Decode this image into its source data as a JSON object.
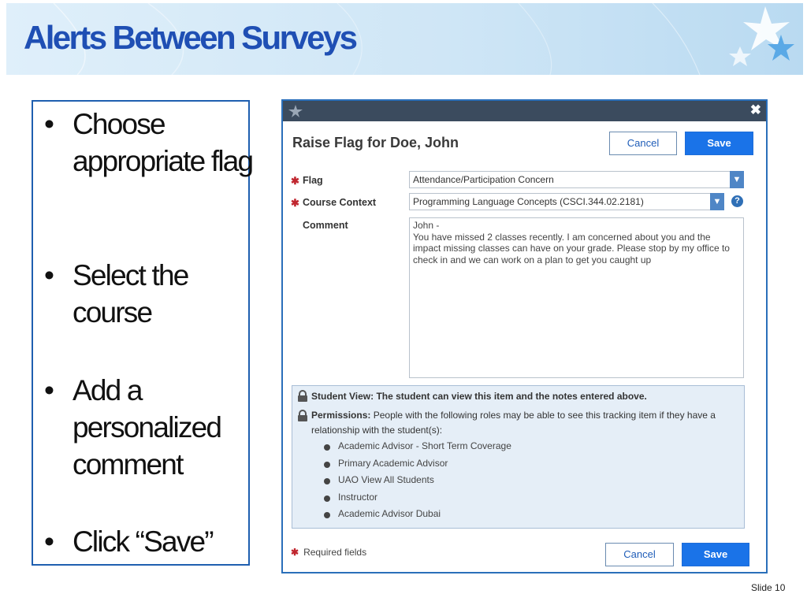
{
  "slide": {
    "title": "Alerts Between Surveys",
    "slide_number": "Slide 10",
    "bullets": [
      "Choose appropriate flag",
      "Select the course",
      "Add a personalized comment",
      "Click “Save”"
    ]
  },
  "dialog": {
    "heading": "Raise Flag for Doe, John",
    "close_glyph": "✖",
    "cancel_label": "Cancel",
    "save_label": "Save",
    "required_star": "✱",
    "fields": {
      "flag_label": "Flag",
      "flag_value": "Attendance/Participation Concern",
      "course_label": "Course Context",
      "course_value": "Programming Language Concepts (CSCI.344.02.2181)",
      "comment_label": "Comment",
      "comment_value": "John -\nYou have missed 2 classes recently. I am concerned about you and the impact missing classes can have on your grade. Please stop by my office to check in and we can work on a plan to get you caught up"
    },
    "info": {
      "student_view": "Student View: The student can view this item and the notes entered above.",
      "permissions_label": "Permissions:",
      "permissions_text": "People with the following roles may be able to see this tracking item if they have a relationship with the student(s):",
      "roles": [
        "Academic Advisor - Short Term Coverage",
        "Primary Academic Advisor",
        "UAO View All Students",
        "Instructor",
        "Academic Advisor Dubai"
      ]
    },
    "required_fields": "Required fields",
    "help_glyph": "?"
  },
  "colors": {
    "title_blue": "#1f4fb4",
    "save_blue": "#1a73e8",
    "required_red": "#c0262f",
    "titlebar": "#3b4b5e"
  }
}
